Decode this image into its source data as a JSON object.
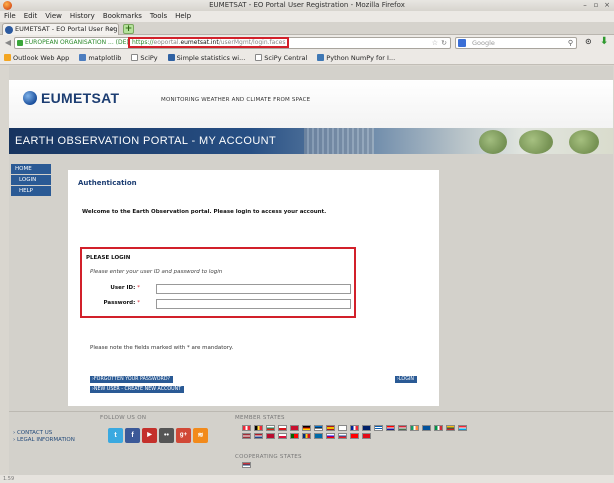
{
  "window": {
    "title": "EUMETSAT - EO Portal User Registration - Mozilla Firefox",
    "controls": [
      "–",
      "▫",
      "×"
    ]
  },
  "menu": [
    "File",
    "Edit",
    "View",
    "History",
    "Bookmarks",
    "Tools",
    "Help"
  ],
  "tab": {
    "label": "EUMETSAT - EO Portal User Regis...",
    "close": "×",
    "new_tab": "+"
  },
  "nav": {
    "identity": "EUROPEAN ORGANISATION ... (DE)",
    "url_scheme": "https://",
    "url_sub": "eoportal.",
    "url_host": "eumetsat.int",
    "url_path": "/userMgmt/login.faces",
    "search_placeholder": "Google"
  },
  "bookmarks": [
    "Outlook Web App",
    "matplotlib",
    "SciPy",
    "Simple statistics wi...",
    "SciPy Central",
    "Python NumPy for I..."
  ],
  "site": {
    "logo": "EUMETSAT",
    "tagline": "MONITORING WEATHER AND CLIMATE FROM SPACE",
    "banner": "EARTH OBSERVATION PORTAL - MY ACCOUNT"
  },
  "leftnav": [
    {
      "label": "HOME",
      "sub": false
    },
    {
      "label": "LOGIN",
      "sub": true
    },
    {
      "label": "HELP",
      "sub": true
    }
  ],
  "auth": {
    "title": "Authentication",
    "welcome": "Welcome to the Earth Observation portal. Please login to access your account.",
    "box_title": "PLEASE LOGIN",
    "hint": "Please enter your user ID and password to login",
    "userid_label": "User ID:",
    "password_label": "Password:",
    "required_mark": "*",
    "mandatory_note": "Please note the fields marked with * are mandatory.",
    "forgot": "›FORGOTTEN YOUR PASSWORD?",
    "new_user": "›NEW USER - CREATE NEW ACCOUNT",
    "login": "›LOGIN"
  },
  "footer": {
    "links": [
      "› CONTACT US",
      "› LEGAL INFORMATION"
    ],
    "follow": "FOLLOW US ON",
    "member_states": "MEMBER STATES",
    "cooperating": "COOPERATING STATES",
    "social": [
      {
        "name": "twitter",
        "glyph": "t",
        "color": "#3aa9e0"
      },
      {
        "name": "facebook",
        "glyph": "f",
        "color": "#3b5998"
      },
      {
        "name": "youtube",
        "glyph": "▶",
        "color": "#c4302b"
      },
      {
        "name": "flickr",
        "glyph": "••",
        "color": "#555555"
      },
      {
        "name": "google-plus",
        "glyph": "g+",
        "color": "#d14836"
      },
      {
        "name": "rss",
        "glyph": "≋",
        "color": "#f28a1b"
      }
    ]
  },
  "status": "1.59"
}
